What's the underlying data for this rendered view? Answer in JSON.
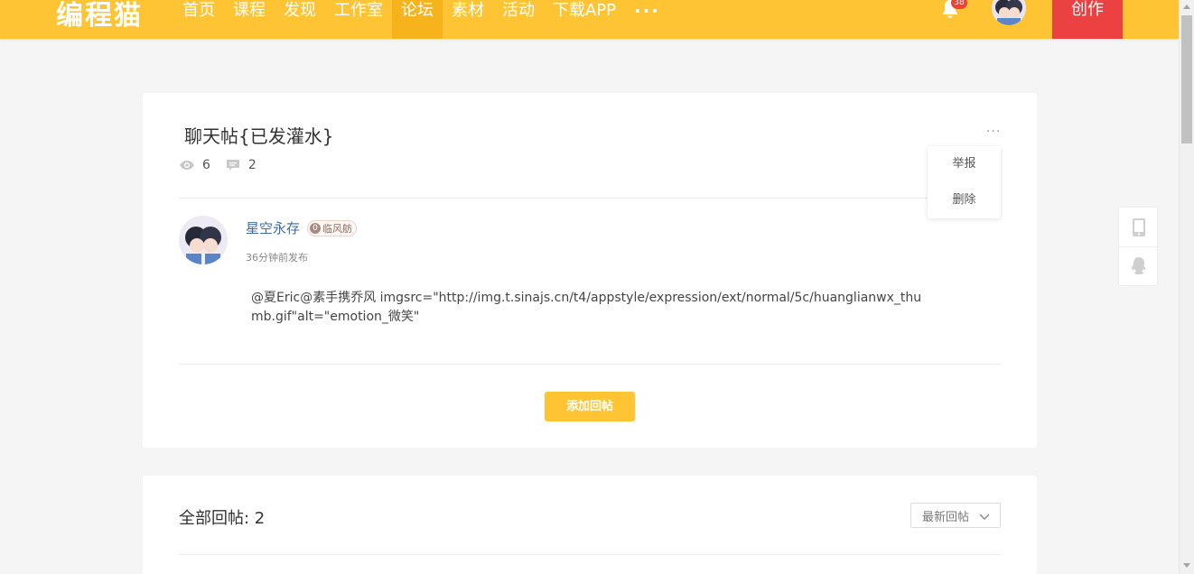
{
  "header": {
    "logo": "编程猫",
    "nav": [
      {
        "label": "首页",
        "active": false
      },
      {
        "label": "课程",
        "active": false
      },
      {
        "label": "发现",
        "active": false
      },
      {
        "label": "工作室",
        "active": false
      },
      {
        "label": "论坛",
        "active": true
      },
      {
        "label": "素材",
        "active": false
      },
      {
        "label": "活动",
        "active": false
      },
      {
        "label": "下载APP",
        "active": false
      }
    ],
    "more_label": "···",
    "notification_count": "38",
    "create_label": "创作",
    "icons": {
      "bell": "bell-icon",
      "avatar": "avatar"
    }
  },
  "post": {
    "title": "聊天帖{已发灌水}",
    "views": "6",
    "comments": "2",
    "more_menu": {
      "label": "···",
      "items": [
        "举报",
        "删除"
      ]
    },
    "author": {
      "name": "星空永存",
      "rank_icon": "0",
      "rank_label": "临风舫",
      "time": "36分钟前发布"
    },
    "body": "@夏Eric@素手携乔风 imgsrc=\"http://img.t.sinajs.cn/t4/appstyle/expression/ext/normal/5c/huanglianwx_thumb.gif\"alt=\"emotion_微笑\"",
    "add_reply_label": "添加回帖"
  },
  "replies": {
    "title": "全部回帖: 2",
    "sort_label": "最新回帖"
  },
  "colors": {
    "header_bg": "#fec433",
    "nav_active_bg": "#f7b31c",
    "create_bg": "#ec4141",
    "author_link": "#3f6aa6"
  }
}
